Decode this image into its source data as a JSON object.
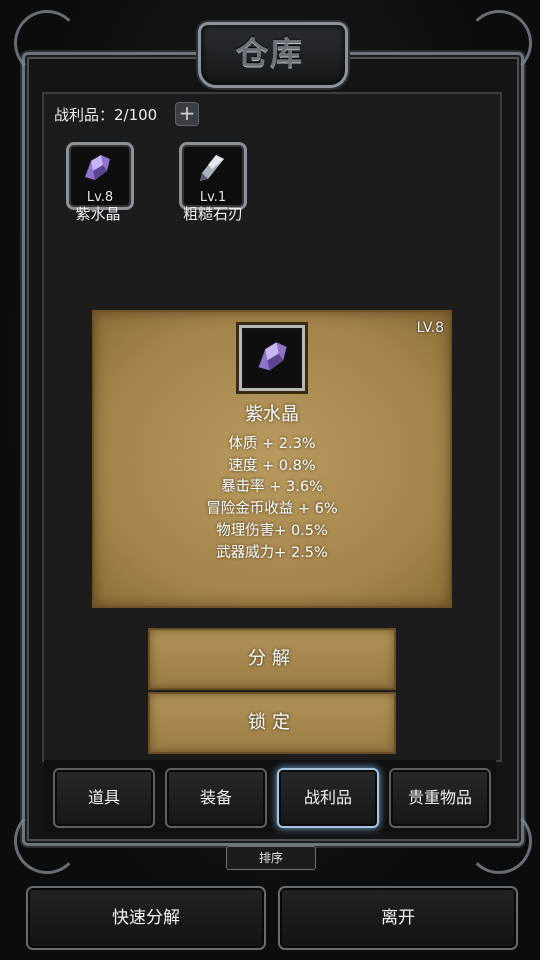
{
  "window": {
    "title": "仓库"
  },
  "loot": {
    "label": "战利品：2/100",
    "add_symbol": "+"
  },
  "items": [
    {
      "level": "Lv.8",
      "name": "紫水晶",
      "icon": "amethyst-icon"
    },
    {
      "level": "Lv.1",
      "name": "粗糙石刃",
      "icon": "rough-stone-blade-icon"
    }
  ],
  "detail": {
    "level": "LV.8",
    "name": "紫水晶",
    "stats": [
      "体质 + 2.3%",
      "速度 + 0.8%",
      "暴击率 + 3.6%",
      "冒险金币收益 + 6%",
      "物理伤害+ 0.5%",
      "武器威力+ 2.5%"
    ],
    "actions": {
      "decompose": "分解",
      "lock": "锁定"
    }
  },
  "tabs": [
    {
      "label": "道具",
      "active": false
    },
    {
      "label": "装备",
      "active": false
    },
    {
      "label": "战利品",
      "active": true
    },
    {
      "label": "贵重物品",
      "active": false
    }
  ],
  "sort_label": "排序",
  "bottom": {
    "quick_decompose": "快速分解",
    "leave": "离开"
  },
  "colors": {
    "parchment": "#a98a51",
    "active_tab_glow": "#7fb0dd",
    "frame_metal": "#8b949c"
  }
}
